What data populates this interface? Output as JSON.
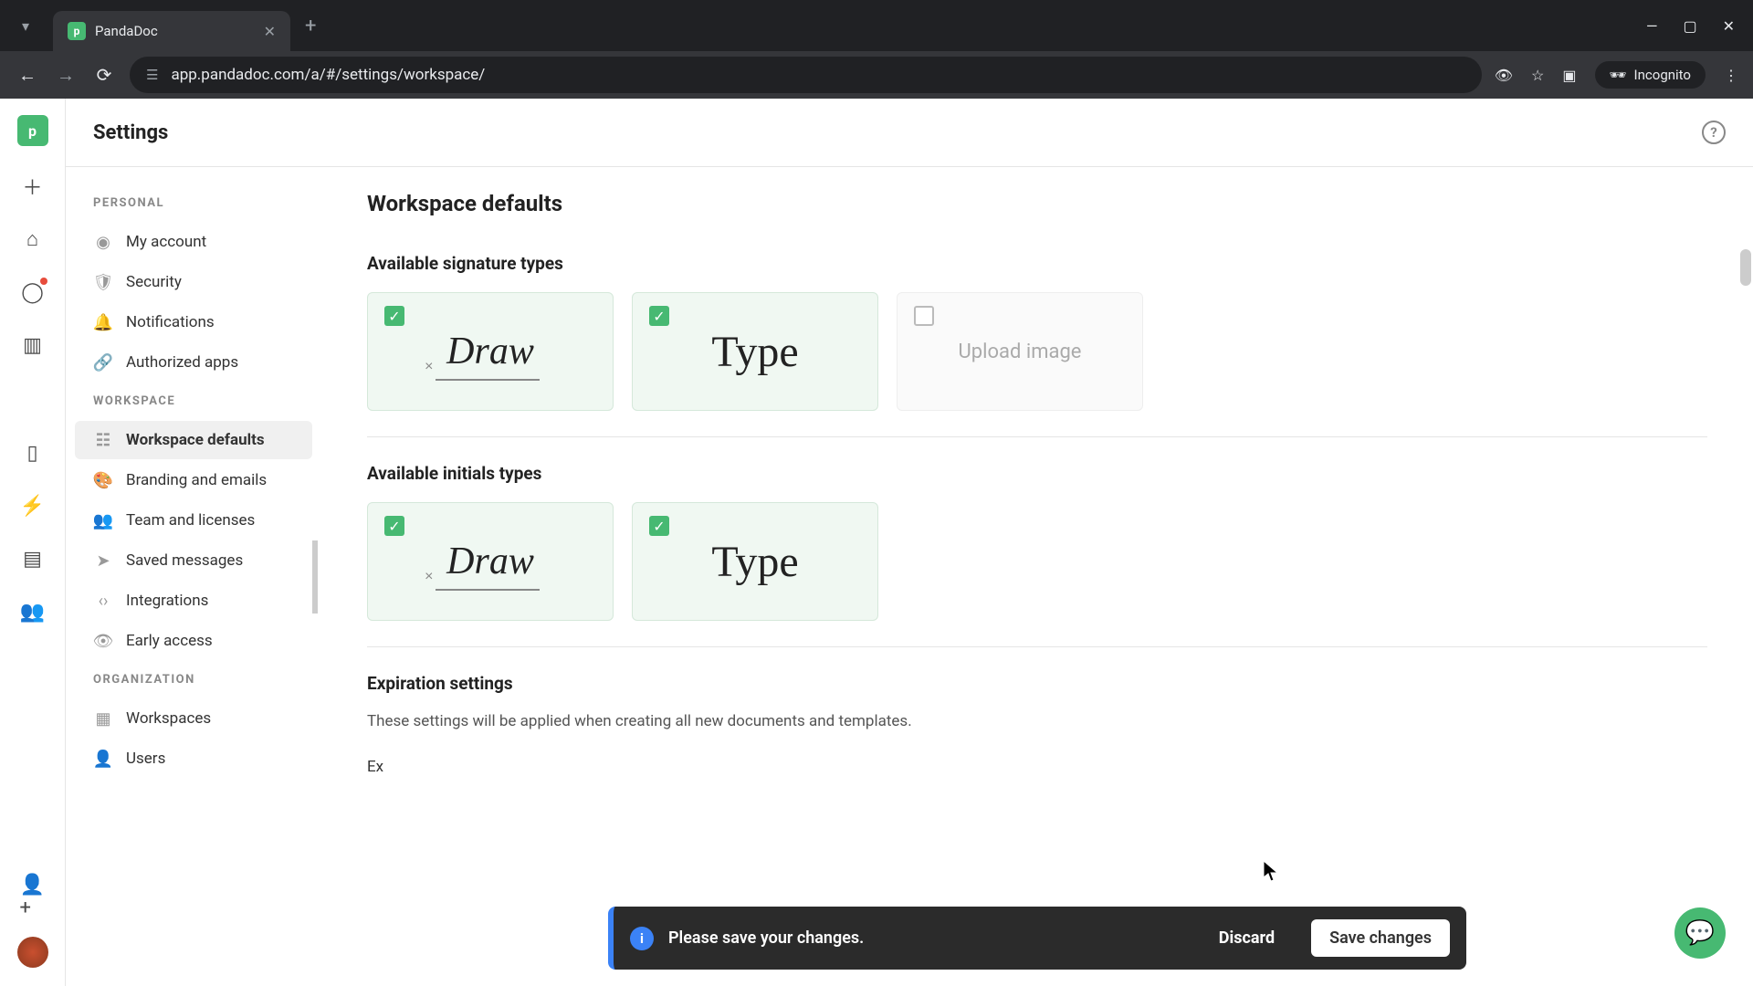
{
  "browser": {
    "tab_title": "PandaDoc",
    "url": "app.pandadoc.com/a/#/settings/workspace/",
    "incognito_label": "Incognito"
  },
  "page": {
    "title": "Settings",
    "main_heading": "Workspace defaults"
  },
  "nav": {
    "personal": {
      "header": "PERSONAL",
      "items": [
        "My account",
        "Security",
        "Notifications",
        "Authorized apps"
      ]
    },
    "workspace": {
      "header": "WORKSPACE",
      "items": [
        "Workspace defaults",
        "Branding and emails",
        "Team and licenses",
        "Saved messages",
        "Integrations",
        "Early access"
      ]
    },
    "organization": {
      "header": "ORGANIZATION",
      "items": [
        "Workspaces",
        "Users"
      ]
    }
  },
  "sections": {
    "sig_title": "Available signature types",
    "initials_title": "Available initials types",
    "expiration_title": "Expiration settings",
    "expiration_desc": "These settings will be applied when creating all new documents and templates.",
    "expires_inline": "Ex"
  },
  "sig_options": {
    "draw": {
      "label": "Draw",
      "checked": true
    },
    "type": {
      "label": "Type",
      "checked": true
    },
    "upload": {
      "label": "Upload image",
      "checked": false
    }
  },
  "initials_options": {
    "draw": {
      "label": "Draw",
      "checked": true
    },
    "type": {
      "label": "Type",
      "checked": true
    }
  },
  "toast": {
    "message": "Please save your changes.",
    "discard": "Discard",
    "save": "Save changes"
  }
}
